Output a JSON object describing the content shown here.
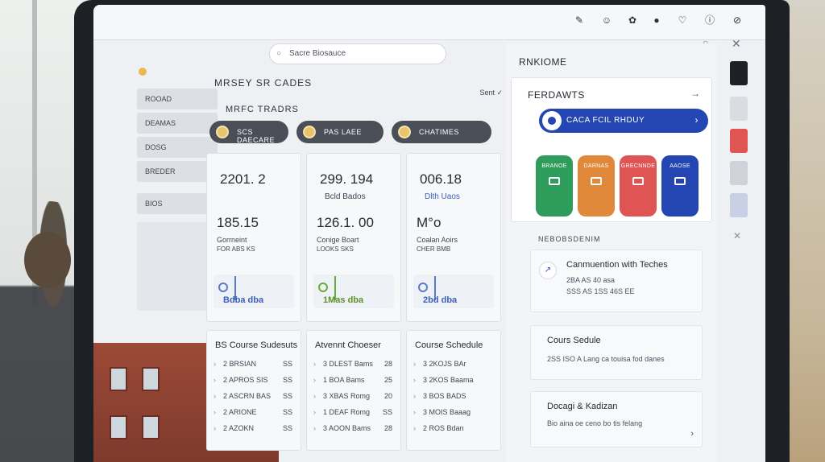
{
  "toolbar": {
    "url_text": "Sacre Biosauce",
    "icons": [
      "edit-icon",
      "smiley-icon",
      "palette-icon",
      "record-icon",
      "heart-icon",
      "info-icon",
      "compass-icon"
    ]
  },
  "main": {
    "title": "MRSEY SR CADES",
    "sort_label": "Sent",
    "subtitle": "MRFC TRADRS",
    "pills": [
      "SCS DAECARE",
      "PAS LAEE",
      "CHATIMES"
    ],
    "cards": [
      {
        "big1": "2201. 2",
        "lbl1": "",
        "big2": "185.15",
        "lbl2": "Gorrneint",
        "lbl3": "FOR ABS KS",
        "mini": "Bdba dba"
      },
      {
        "big1": "299. 194",
        "lbl1": "Bcld Bados",
        "big2": "126.1. 00",
        "lbl2": "Conige Boart",
        "lbl3": "LOOKS SKS",
        "mini": "1Mas dba"
      },
      {
        "big1": "006.18",
        "lbl1": "Dlth Uaos",
        "big2": "M°o",
        "lbl2": "Coalan Aoirs",
        "lbl3": "CHER BMB",
        "mini": "2bd dba"
      }
    ],
    "lists": [
      {
        "header": "BS Course Sudesuts",
        "rows": [
          {
            "t": "2 BRSIAN",
            "n": "SS"
          },
          {
            "t": "2 APROS SIS",
            "n": "SS"
          },
          {
            "t": "2 ASCRN BAS",
            "n": "SS"
          },
          {
            "t": "2 ARIONE",
            "n": "SS"
          },
          {
            "t": "2 AZOKN",
            "n": "SS"
          }
        ]
      },
      {
        "header": "Atvennt Choeser",
        "rows": [
          {
            "t": "3 DLEST Bams",
            "n": "28"
          },
          {
            "t": "1 BOA Bams",
            "n": "25"
          },
          {
            "t": "3 XBAS Romg",
            "n": "20"
          },
          {
            "t": "1 DEAF Romg",
            "n": "SS"
          },
          {
            "t": "3 AOON Bams",
            "n": "28"
          }
        ]
      },
      {
        "header": "Course Schedule",
        "rows": [
          {
            "t": "3 2KOJS BAr",
            "n": ""
          },
          {
            "t": "3 2KOS Baama",
            "n": ""
          },
          {
            "t": "3 BOS BADS",
            "n": ""
          },
          {
            "t": "3 MOIS Baaag",
            "n": ""
          },
          {
            "t": "2 ROS Bdan",
            "n": ""
          }
        ]
      }
    ]
  },
  "sidebar": {
    "items": [
      "ROOAD",
      "DEAMAS",
      "DOSG",
      "BREDER",
      "BIOS"
    ]
  },
  "right": {
    "header": "RNKIOME",
    "top_title": "FERDAWTS",
    "blue_button": "CACA FCIL RHDUY",
    "tiles": [
      {
        "label": "BRANOE",
        "color": "#2e9c5b"
      },
      {
        "label": "DARNAS",
        "color": "#e0893a"
      },
      {
        "label": "GRECNNDE",
        "color": "#e05454"
      },
      {
        "label": "AAOSE",
        "color": "#2346b3"
      }
    ],
    "section_label": "NEBOBSDENIM",
    "cards": [
      {
        "title": "Canmuention with Teches",
        "line1": "2BA AS 40 asa",
        "line2": "SSS AS 1SS 46S EE"
      },
      {
        "title": "Cours Sedule",
        "line1": "2SS ISO A Lang ca touisa fod danes",
        "line2": ""
      },
      {
        "title": "Docagi & Kadizan",
        "line1": "Bio aina oe ceno bo tis felang",
        "line2": ""
      }
    ]
  }
}
